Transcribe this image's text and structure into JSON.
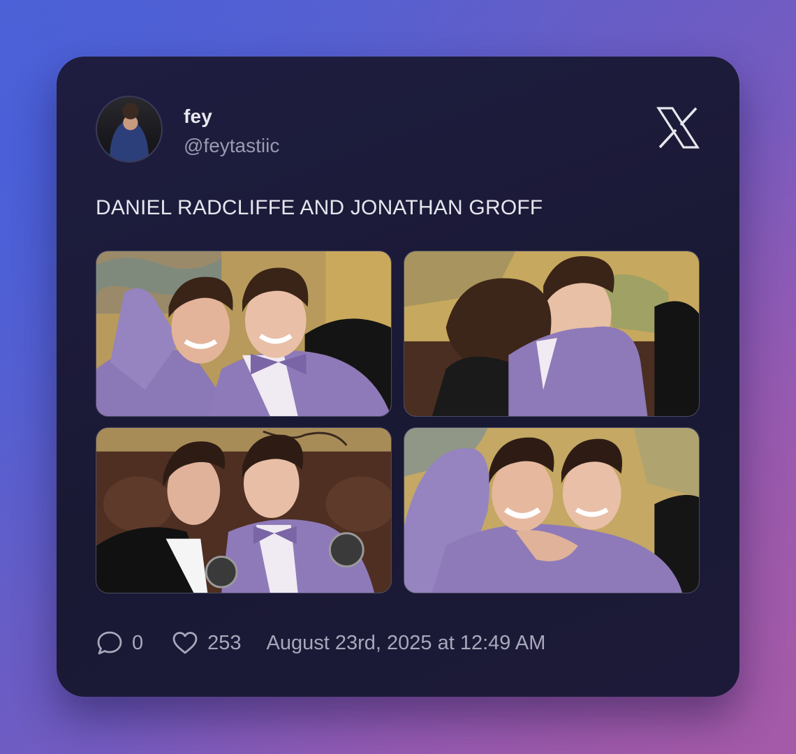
{
  "tweet": {
    "author_name": "fey",
    "author_handle": "@feytastiic",
    "text": "DANIEL RADCLIFFE AND JONATHAN GROFF",
    "reply_count": "0",
    "like_count": "253",
    "timestamp": "August 23rd, 2025 at 12:49 AM"
  },
  "icons": {
    "brand": "x-logo-icon",
    "reply": "reply-icon",
    "like": "heart-icon"
  },
  "colors": {
    "card_background": "#1b1a38",
    "text_primary": "#e6e6ee",
    "text_secondary": "#9a9ab0",
    "suit_purple": "#8e7ab8"
  }
}
